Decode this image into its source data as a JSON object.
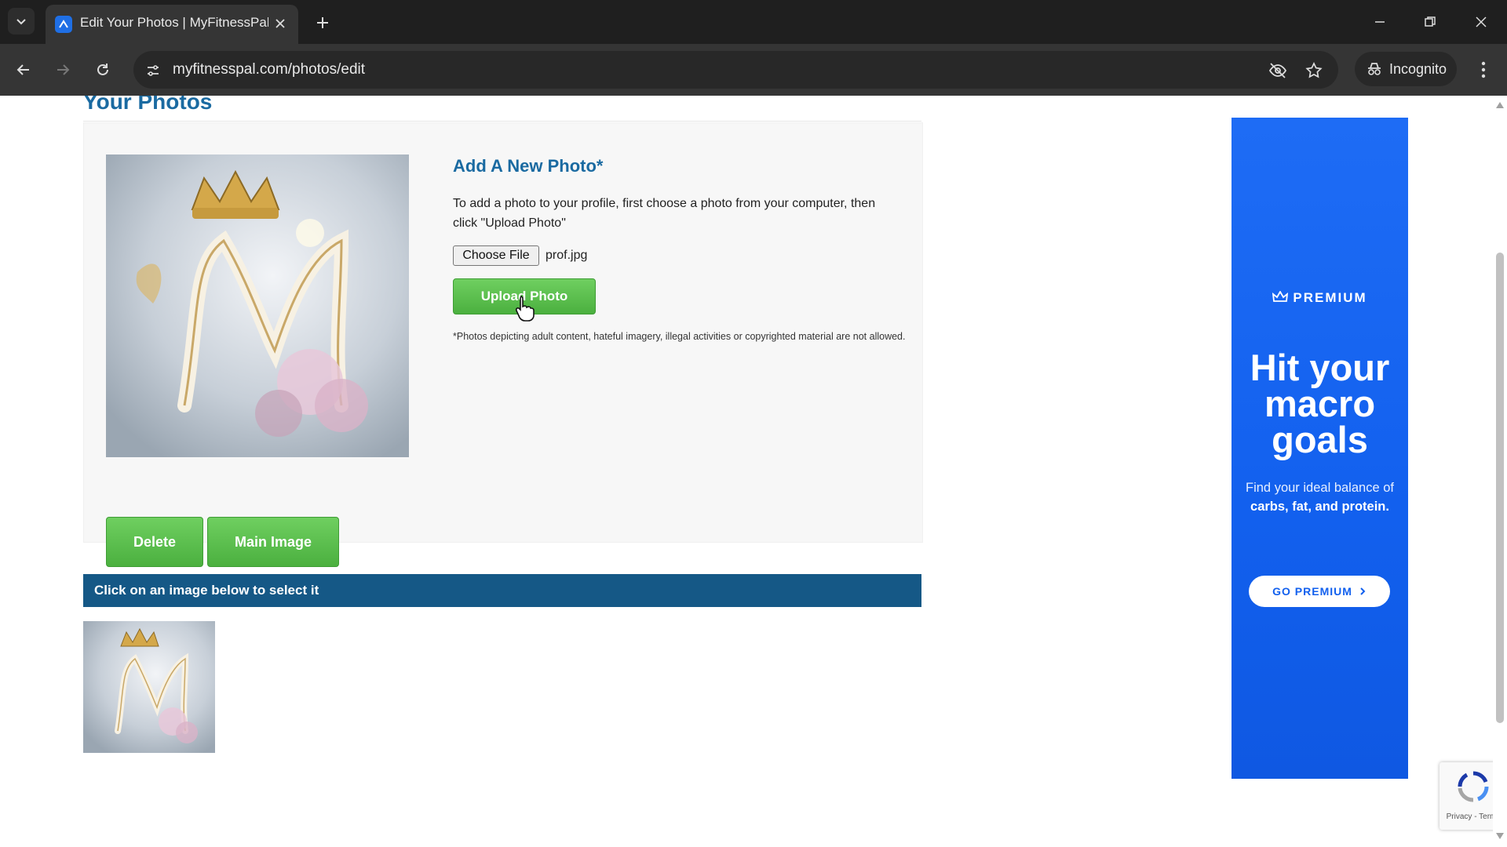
{
  "browser": {
    "tab_title": "Edit Your Photos | MyFitnessPal",
    "url": "myfitnesspal.com/photos/edit",
    "incognito_label": "Incognito"
  },
  "page": {
    "title": "Your Photos",
    "add_heading": "Add A New Photo*",
    "add_description": "To add a photo to your profile, first choose a photo from your computer, then click \"Upload Photo\"",
    "choose_file_label": "Choose File",
    "selected_file": "prof.jpg",
    "upload_button": "Upload Photo",
    "disclaimer": "*Photos depicting adult content, hateful imagery, illegal activities or copyrighted material are not allowed.",
    "delete_button": "Delete",
    "main_image_button": "Main Image",
    "select_prompt": "Click on an image below to select it"
  },
  "ad": {
    "badge": "PREMIUM",
    "headline_line1": "Hit your",
    "headline_line2": "macro",
    "headline_line3": "goals",
    "body_prefix": "Find your ideal balance of ",
    "body_bold": "carbs, fat, and protein.",
    "cta": "GO PREMIUM"
  },
  "recaptcha": {
    "links": "Privacy - Terms"
  },
  "colors": {
    "accent_blue": "#1a6aa1",
    "bar_blue": "#155886",
    "button_green": "#4bb03f",
    "ad_blue": "#1260ee"
  }
}
